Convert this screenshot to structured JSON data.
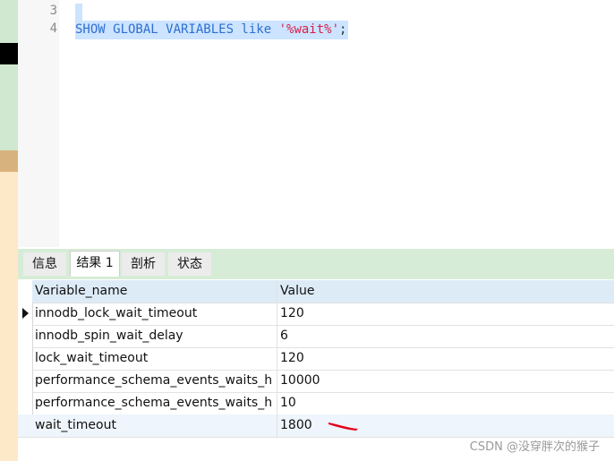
{
  "editor": {
    "line_numbers": [
      "3",
      "4"
    ],
    "sql": {
      "keywords": "SHOW GLOBAL VARIABLES like",
      "string": "'%wait%'",
      "terminator": ";"
    }
  },
  "tabs": [
    {
      "label": "信息",
      "active": false
    },
    {
      "label": "结果 1",
      "active": true
    },
    {
      "label": "剖析",
      "active": false
    },
    {
      "label": "状态",
      "active": false
    }
  ],
  "grid": {
    "columns": [
      "Variable_name",
      "Value"
    ],
    "rows": [
      {
        "name": "innodb_lock_wait_timeout",
        "value": "120"
      },
      {
        "name": "innodb_spin_wait_delay",
        "value": "6"
      },
      {
        "name": "lock_wait_timeout",
        "value": "120"
      },
      {
        "name": "performance_schema_events_waits_h",
        "value": "10000"
      },
      {
        "name": "performance_schema_events_waits_h",
        "value": "10"
      },
      {
        "name": "wait_timeout",
        "value": "1800"
      }
    ]
  },
  "watermark": "CSDN @没穿胖次的猴子",
  "colors": {
    "keyword": "#2f6fd0",
    "string": "#d6204a",
    "selection": "#cce4ff",
    "annotation": "#e4001a"
  }
}
